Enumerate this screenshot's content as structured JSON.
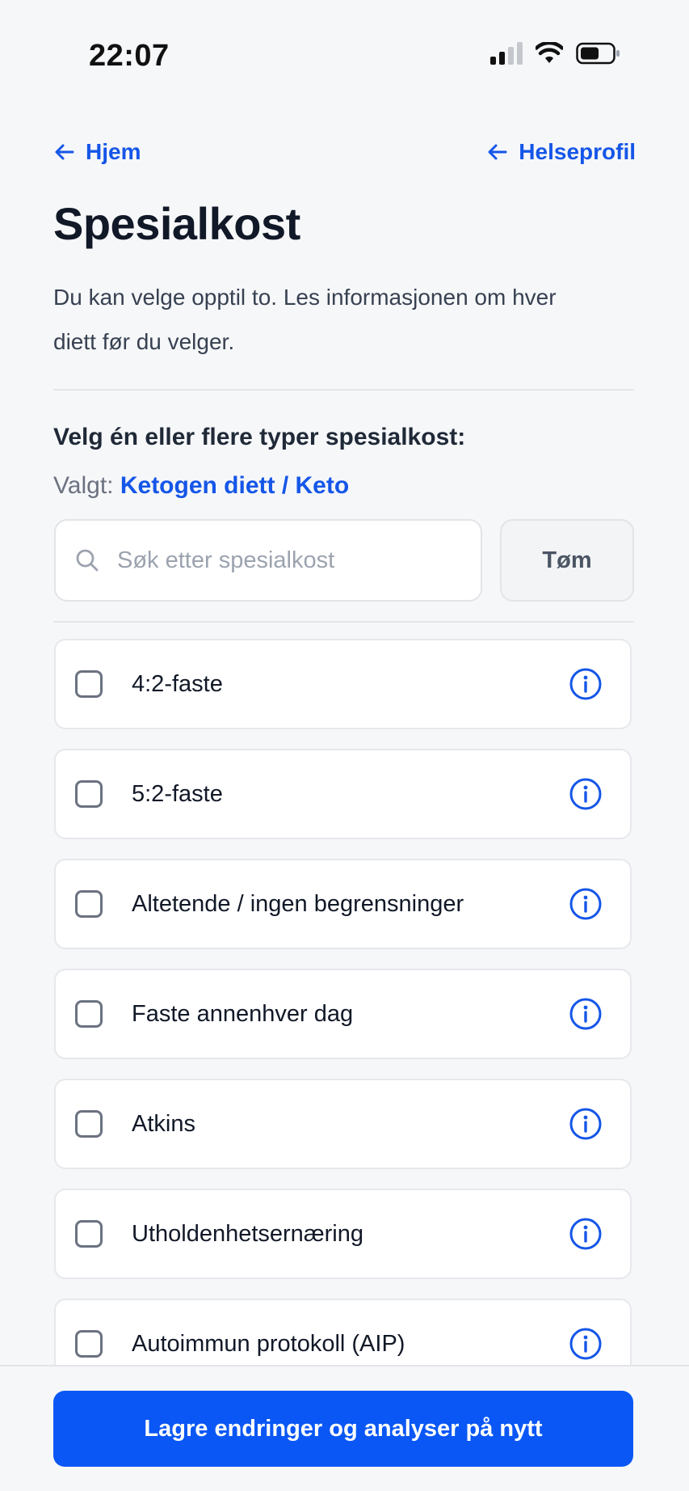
{
  "status_bar": {
    "time": "22:07",
    "icons": [
      "cellular-signal-icon",
      "wifi-icon",
      "battery-icon"
    ]
  },
  "nav": {
    "back_label": "Hjem",
    "forward_label": "Helseprofil"
  },
  "page": {
    "title": "Spesialkost",
    "intro": "Du kan velge opptil to. Les informasjonen om hver diett før du velger."
  },
  "selection": {
    "prompt": "Velg én eller flere typer spesialkost:",
    "selected_prefix": "Valgt:",
    "selected_value": "Ketogen diett / Keto"
  },
  "search": {
    "placeholder": "Søk etter spesialkost",
    "value": "",
    "clear_label": "Tøm"
  },
  "diets": [
    {
      "label": "4:2-faste",
      "checked": false
    },
    {
      "label": "5:2-faste",
      "checked": false
    },
    {
      "label": "Altetende / ingen begrensninger",
      "checked": false
    },
    {
      "label": "Faste annenhver dag",
      "checked": false
    },
    {
      "label": "Atkins",
      "checked": false
    },
    {
      "label": "Utholdenhetsernæring",
      "checked": false
    },
    {
      "label": "Autoimmun protokoll (AIP)",
      "checked": false
    }
  ],
  "footer": {
    "save_label": "Lagre endringer og analyser på nytt"
  },
  "colors": {
    "accent": "#1556e8",
    "primary_button": "#0a57f5",
    "background": "#f6f7f9"
  }
}
